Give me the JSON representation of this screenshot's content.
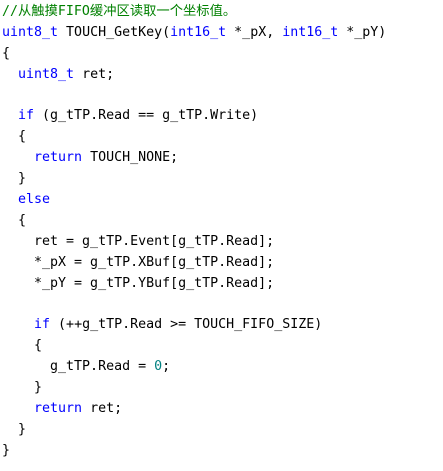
{
  "editor": {
    "colors": {
      "comment": "#008000",
      "keyword": "#0000ff",
      "number": "#008080",
      "text": "#000000",
      "background": "#ffffff"
    },
    "lines": [
      [
        {
          "t": "//从触摸FIFO缓冲区读取一个坐标值。",
          "k": "comment"
        }
      ],
      [
        {
          "t": "uint8_t",
          "k": "type"
        },
        {
          "t": " TOUCH_GetKey(",
          "k": "plain"
        },
        {
          "t": "int16_t",
          "k": "type"
        },
        {
          "t": " *_pX, ",
          "k": "plain"
        },
        {
          "t": "int16_t",
          "k": "type"
        },
        {
          "t": " *_pY)",
          "k": "plain"
        }
      ],
      [
        {
          "t": "{",
          "k": "punct"
        }
      ],
      [
        {
          "t": "  ",
          "k": "plain"
        },
        {
          "t": "uint8_t",
          "k": "type"
        },
        {
          "t": " ret;",
          "k": "plain"
        }
      ],
      [],
      [
        {
          "t": "  ",
          "k": "plain"
        },
        {
          "t": "if",
          "k": "keyword"
        },
        {
          "t": " (g_tTP.Read == g_tTP.Write)",
          "k": "plain"
        }
      ],
      [
        {
          "t": "  {",
          "k": "punct"
        }
      ],
      [
        {
          "t": "    ",
          "k": "plain"
        },
        {
          "t": "return",
          "k": "keyword"
        },
        {
          "t": " TOUCH_NONE;",
          "k": "plain"
        }
      ],
      [
        {
          "t": "  }",
          "k": "punct"
        }
      ],
      [
        {
          "t": "  ",
          "k": "plain"
        },
        {
          "t": "else",
          "k": "keyword"
        }
      ],
      [
        {
          "t": "  {",
          "k": "punct"
        }
      ],
      [
        {
          "t": "    ret = g_tTP.Event[g_tTP.Read];",
          "k": "plain"
        }
      ],
      [
        {
          "t": "    *_pX = g_tTP.XBuf[g_tTP.Read];",
          "k": "plain"
        }
      ],
      [
        {
          "t": "    *_pY = g_tTP.YBuf[g_tTP.Read];",
          "k": "plain"
        }
      ],
      [],
      [
        {
          "t": "    ",
          "k": "plain"
        },
        {
          "t": "if",
          "k": "keyword"
        },
        {
          "t": " (++g_tTP.Read >= TOUCH_FIFO_SIZE)",
          "k": "plain"
        }
      ],
      [
        {
          "t": "    {",
          "k": "punct"
        }
      ],
      [
        {
          "t": "      g_tTP.Read = ",
          "k": "plain"
        },
        {
          "t": "0",
          "k": "number"
        },
        {
          "t": ";",
          "k": "plain"
        }
      ],
      [
        {
          "t": "    }",
          "k": "punct"
        }
      ],
      [
        {
          "t": "    ",
          "k": "plain"
        },
        {
          "t": "return",
          "k": "keyword"
        },
        {
          "t": " ret;",
          "k": "plain"
        }
      ],
      [
        {
          "t": "  }",
          "k": "punct"
        }
      ],
      [
        {
          "t": "}",
          "k": "punct"
        }
      ]
    ]
  }
}
